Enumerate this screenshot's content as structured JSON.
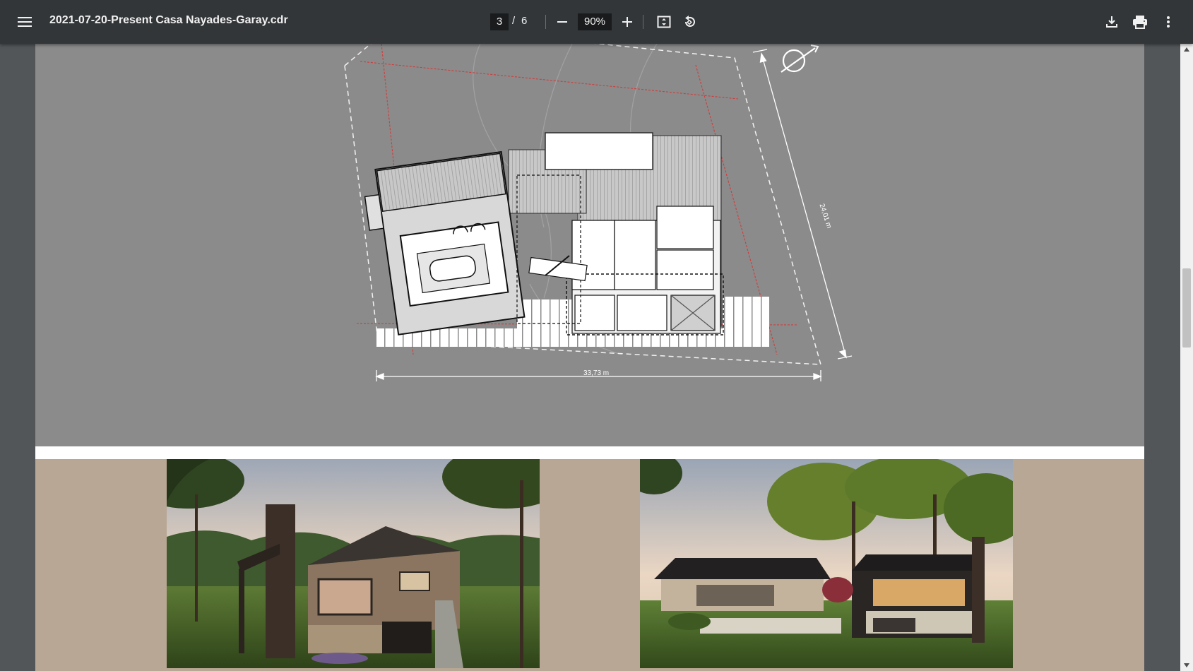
{
  "toolbar": {
    "menu_icon": "hamburger-menu-icon",
    "title": "2021-07-20-Present Casa Nayades-Garay.cdr",
    "page_current": "3",
    "page_separator": "/",
    "page_total": "6",
    "zoom": "90%",
    "zoom_out_icon": "minus-icon",
    "zoom_in_icon": "plus-icon",
    "fit_icon": "fit-to-page-icon",
    "rotate_icon": "rotate-counterclockwise-icon",
    "download_icon": "download-icon",
    "print_icon": "printer-icon",
    "more_icon": "more-vertical-icon"
  },
  "plan": {
    "dimension_width": "33,73 m",
    "dimension_depth": "24,01 m"
  },
  "colors": {
    "toolbar_bg": "#323639",
    "viewer_bg": "#525659",
    "plan_page_bg": "#8b8b8b",
    "render_page_bg": "#b8a794",
    "property_line": "#d23b3b"
  }
}
